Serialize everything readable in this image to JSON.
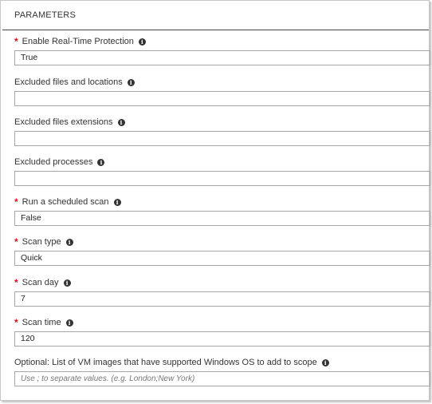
{
  "section": {
    "title": "PARAMETERS"
  },
  "fields": [
    {
      "label": "Enable Real-Time Protection",
      "required": true,
      "value": "True",
      "placeholder": ""
    },
    {
      "label": "Excluded files and locations",
      "required": false,
      "value": "",
      "placeholder": ""
    },
    {
      "label": "Excluded files extensions",
      "required": false,
      "value": "",
      "placeholder": ""
    },
    {
      "label": "Excluded processes",
      "required": false,
      "value": "",
      "placeholder": ""
    },
    {
      "label": "Run a scheduled scan",
      "required": true,
      "value": "False",
      "placeholder": ""
    },
    {
      "label": "Scan type",
      "required": true,
      "value": "Quick",
      "placeholder": ""
    },
    {
      "label": "Scan day",
      "required": true,
      "value": "7",
      "placeholder": ""
    },
    {
      "label": "Scan time",
      "required": true,
      "value": "120",
      "placeholder": ""
    },
    {
      "label": "Optional: List of VM images that have supported Windows OS to add to scope",
      "required": false,
      "value": "",
      "placeholder": "Use ; to separate values. (e.g. London;New York)"
    }
  ],
  "icons": {
    "info": "info-icon",
    "required": "*"
  },
  "colors": {
    "required": "#e00b1c",
    "border": "#a6a6a6",
    "text": "#333333"
  }
}
